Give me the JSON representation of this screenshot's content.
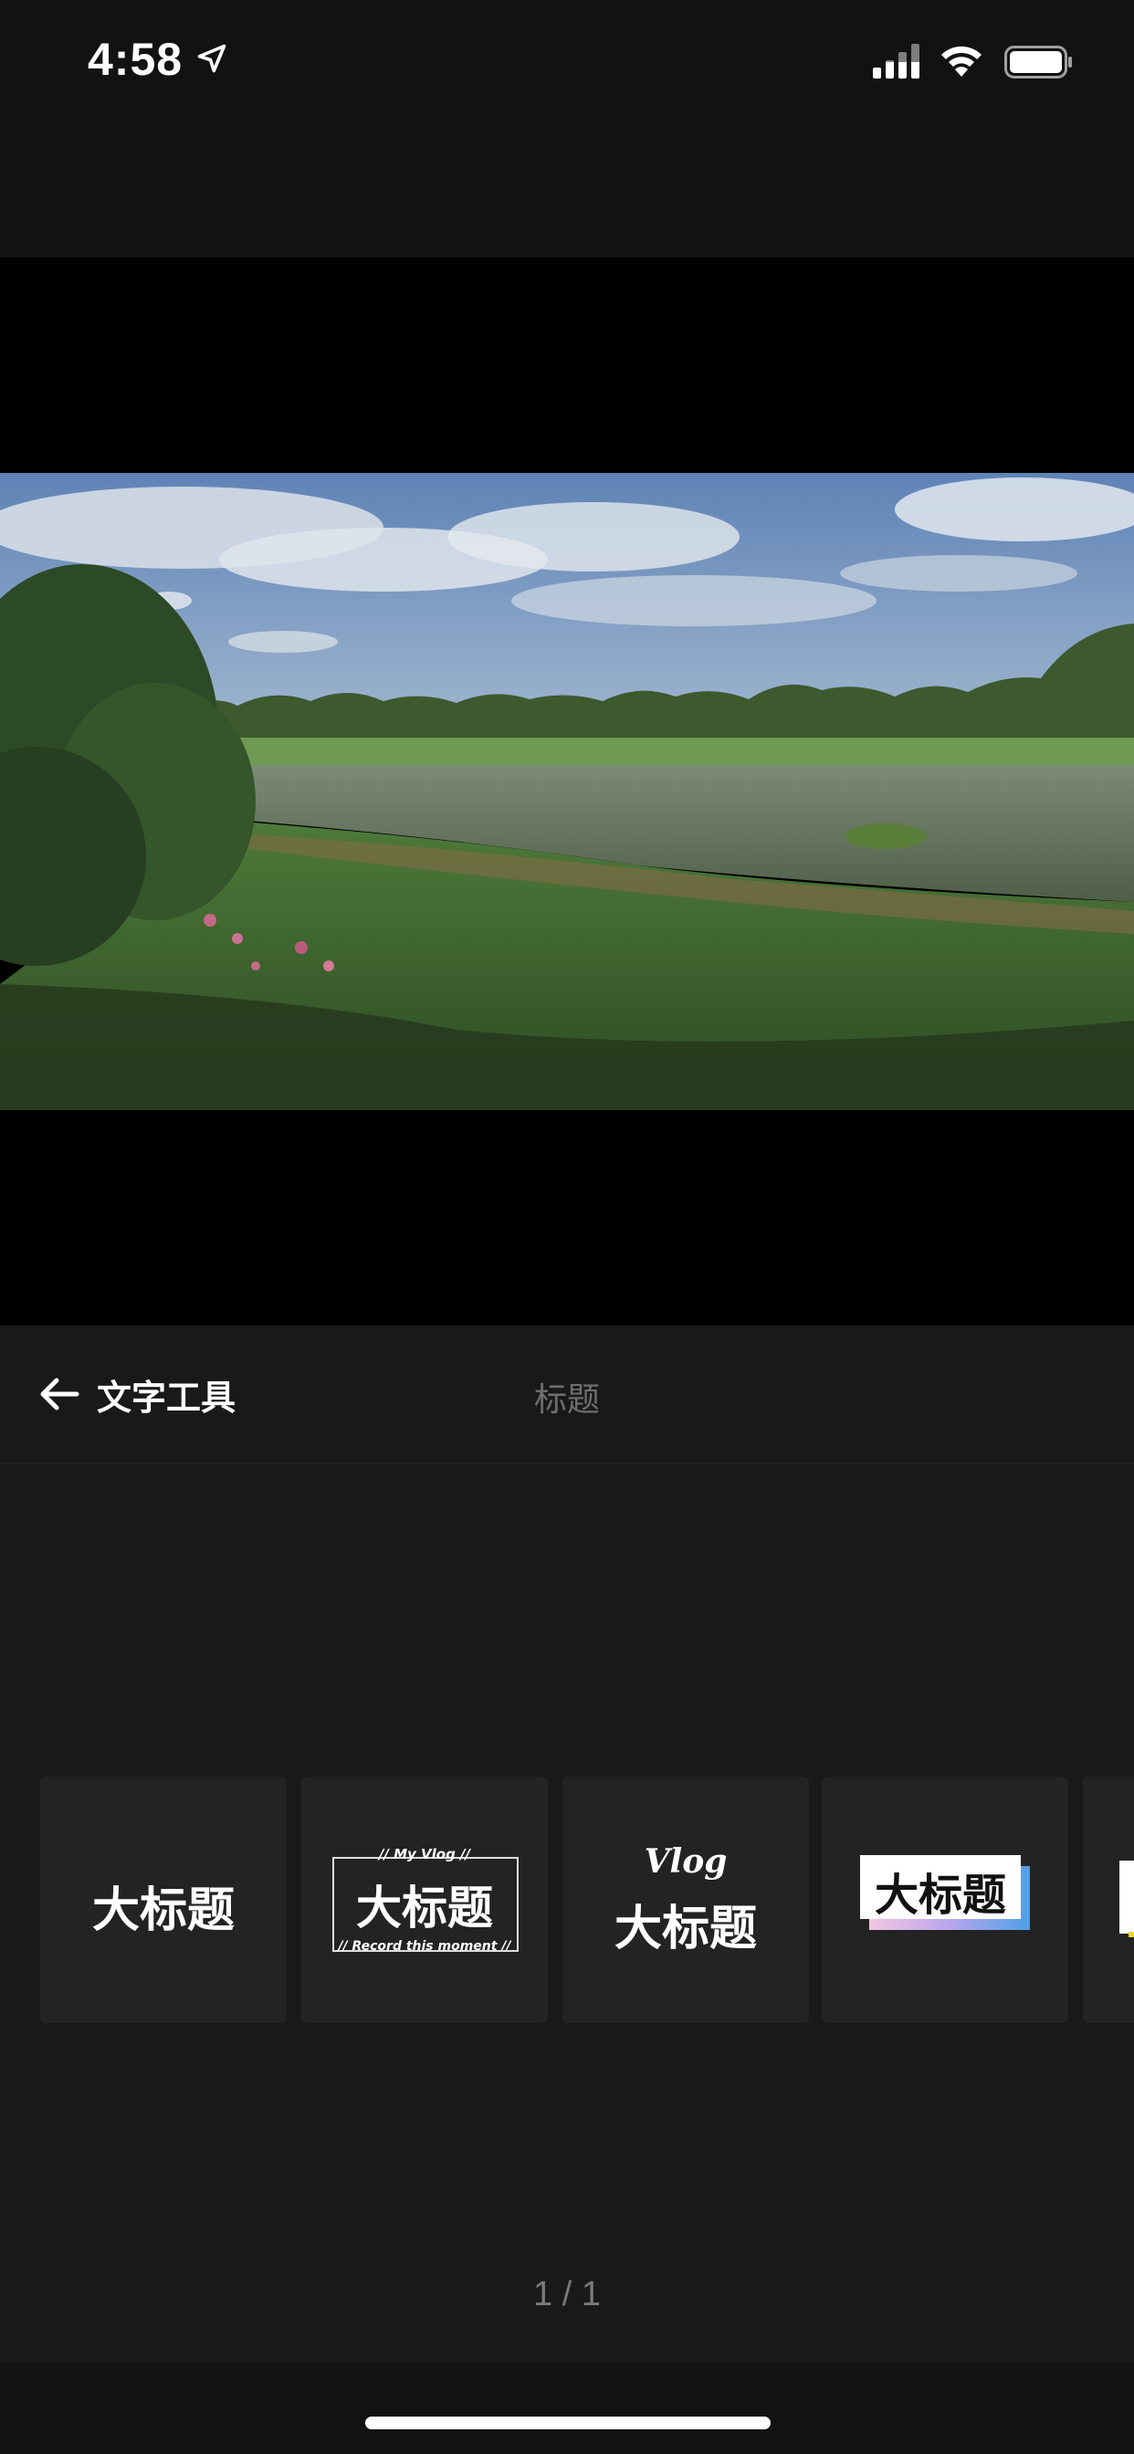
{
  "status_bar": {
    "time": "4:58",
    "location_icon": "location-arrow-icon",
    "signal_icon": "cellular-signal-icon",
    "wifi_icon": "wifi-icon",
    "battery_icon": "battery-icon"
  },
  "tool_header": {
    "back_icon": "back-arrow-icon",
    "title": "文字工具",
    "tab_label": "标题"
  },
  "templates": [
    {
      "main": "大标题"
    },
    {
      "main": "大标题",
      "top": "// My Vlog //",
      "bottom": "// Record this moment //"
    },
    {
      "main": "大标题",
      "script": "Vlog"
    },
    {
      "main": "大标题"
    }
  ],
  "pagination": "1 / 1"
}
